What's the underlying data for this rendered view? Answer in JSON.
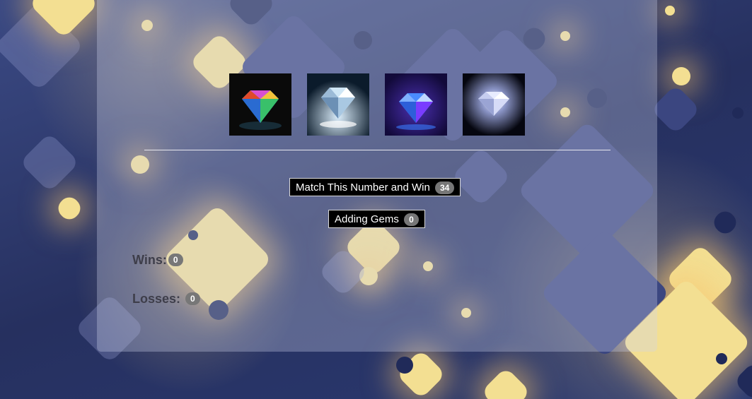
{
  "gems": [
    {
      "name": "multicolor-diamond",
      "colors": [
        "#1a1a1a",
        "#e04a2a",
        "#2fb0e0",
        "#f2c23a"
      ]
    },
    {
      "name": "clear-diamond",
      "colors": [
        "#0b1b2b",
        "#cfe6f5",
        "#6c90b5",
        "#ffffff"
      ]
    },
    {
      "name": "blue-diamond",
      "colors": [
        "#120a3a",
        "#4a8cff",
        "#7a3cff",
        "#c0d8ff"
      ]
    },
    {
      "name": "white-diamond",
      "colors": [
        "#05060f",
        "#e8ecff",
        "#8a94c6",
        "#ffffff"
      ]
    }
  ],
  "target": {
    "label": "Match This Number and Win",
    "value": "34"
  },
  "total": {
    "label": "Adding Gems",
    "value": "0"
  },
  "wins": {
    "label": "Wins:",
    "value": "0"
  },
  "losses": {
    "label": "Losses:",
    "value": "0"
  }
}
